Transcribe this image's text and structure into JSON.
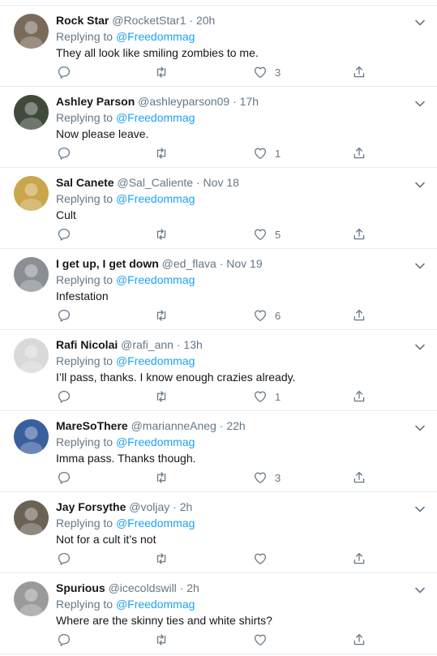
{
  "replying_prefix": "Replying to",
  "tweets": [
    {
      "name": "Rock Star",
      "handle": "@RocketStar1",
      "time": "20h",
      "reply_to": "@Freedommag",
      "text": "They all look like smiling zombies to me.",
      "likes": "3",
      "avatar_color": "#7a6a5a"
    },
    {
      "name": "Ashley Parson",
      "handle": "@ashleyparson09",
      "time": "17h",
      "reply_to": "@Freedommag",
      "text": "Now please leave.",
      "likes": "1",
      "avatar_color": "#3f4a3c"
    },
    {
      "name": "Sal Canete",
      "handle": "@Sal_Caliente",
      "time": "Nov 18",
      "reply_to": "@Freedommag",
      "text": "Cult",
      "likes": "5",
      "avatar_color": "#c9a64b"
    },
    {
      "name": "I get up, I get down",
      "handle": "@ed_flava",
      "time": "Nov 19",
      "reply_to": "@Freedommag",
      "text": "Infestation",
      "likes": "6",
      "avatar_color": "#8a8f96"
    },
    {
      "name": "Rafi Nicolai",
      "handle": "@rafi_ann",
      "time": "13h",
      "reply_to": "@Freedommag",
      "text": "I’ll pass, thanks. I know enough crazies already.",
      "likes": "1",
      "avatar_color": "#d9d9d9"
    },
    {
      "name": "MareSoThere",
      "handle": "@marianneAneg",
      "time": "22h",
      "reply_to": "@Freedommag",
      "text": "Imma pass. Thanks though.",
      "likes": "3",
      "avatar_color": "#3a5f9e"
    },
    {
      "name": "Jay Forsythe",
      "handle": "@voljay",
      "time": "2h",
      "reply_to": "@Freedommag",
      "text": "Not for a cult it’s not",
      "likes": "",
      "avatar_color": "#6b6256"
    },
    {
      "name": "Spurious",
      "handle": "@icecoldswill",
      "time": "2h",
      "reply_to": "@Freedommag",
      "text": "Where are the skinny ties and white shirts?",
      "likes": "",
      "avatar_color": "#9a9a9a"
    }
  ]
}
